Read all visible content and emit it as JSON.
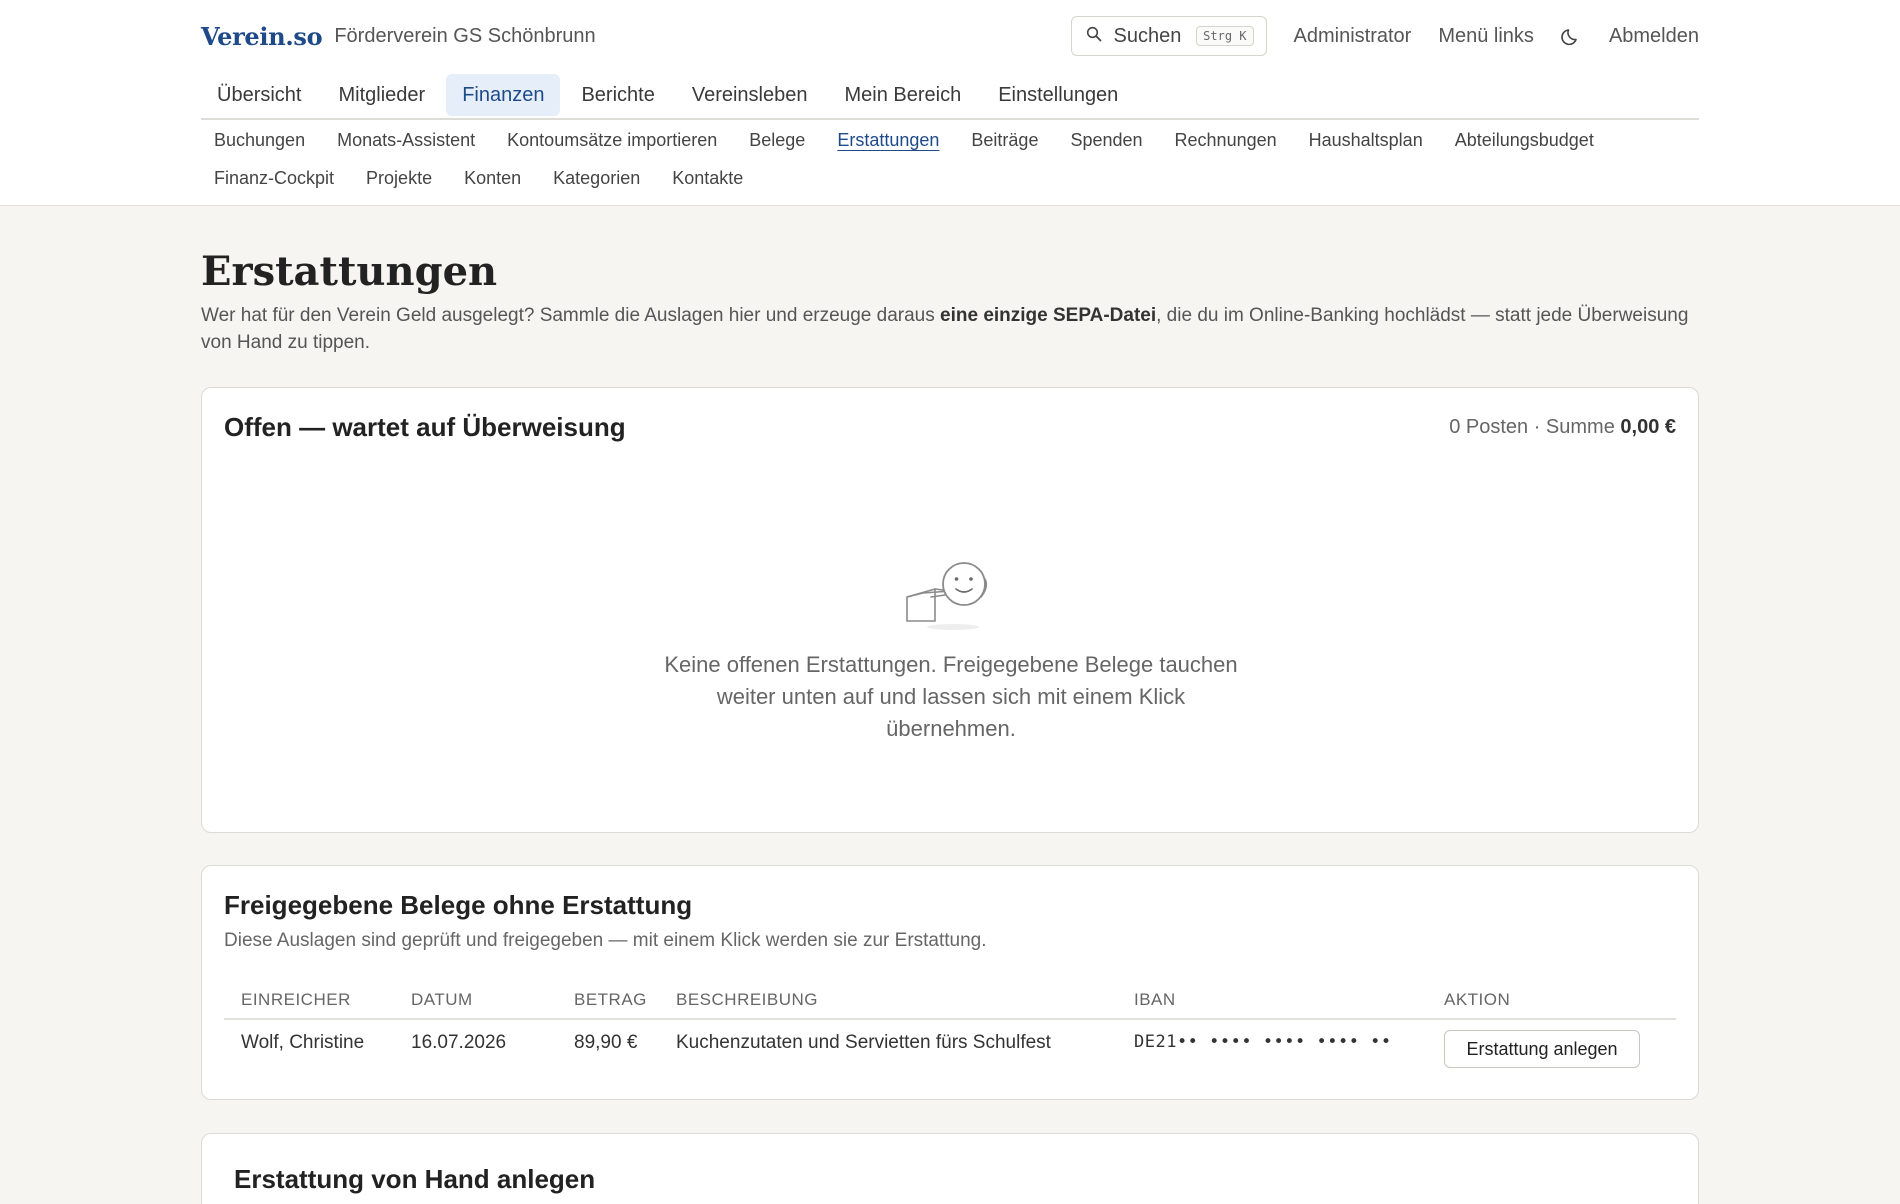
{
  "header": {
    "logo": "Verein.so",
    "org_name": "Förderverein GS Schönbrunn",
    "search": {
      "label": "Suchen",
      "shortcut": "Strg K",
      "icon": "search-icon"
    },
    "user": "Administrator",
    "menu_position": "Menü links",
    "theme_icon": "moon-icon",
    "logout": "Abmelden"
  },
  "main_nav": {
    "tabs": [
      {
        "label": "Übersicht"
      },
      {
        "label": "Mitglieder"
      },
      {
        "label": "Finanzen",
        "active": true
      },
      {
        "label": "Berichte"
      },
      {
        "label": "Vereinsleben"
      },
      {
        "label": "Mein Bereich"
      },
      {
        "label": "Einstellungen"
      }
    ]
  },
  "sub_nav": {
    "items": [
      {
        "label": "Buchungen"
      },
      {
        "label": "Monats-Assistent"
      },
      {
        "label": "Kontoumsätze importieren"
      },
      {
        "label": "Belege"
      },
      {
        "label": "Erstattungen",
        "active": true
      },
      {
        "label": "Beiträge"
      },
      {
        "label": "Spenden"
      },
      {
        "label": "Rechnungen"
      },
      {
        "label": "Haushaltsplan"
      },
      {
        "label": "Abteilungsbudget"
      },
      {
        "label": "Finanz-Cockpit"
      },
      {
        "label": "Projekte"
      },
      {
        "label": "Konten"
      },
      {
        "label": "Kategorien"
      },
      {
        "label": "Kontakte"
      }
    ]
  },
  "page": {
    "title": "Erstattungen",
    "intro_before": "Wer hat für den Verein Geld ausgelegt? Sammle die Auslagen hier und erzeuge daraus ",
    "intro_bold": "eine einzige SEPA-Datei",
    "intro_after": ", die du im Online-Banking hochlädst — statt jede Überweisung von Hand zu tippen."
  },
  "open_card": {
    "title": "Offen — wartet auf Überweisung",
    "count_text": "0 Posten · Summe ",
    "sum": "0,00 €",
    "empty_text": "Keine offenen Erstattungen. Freigegebene Belege tauchen weiter unten auf und lassen sich mit einem Klick übernehmen."
  },
  "approved_card": {
    "title": "Freigegebene Belege ohne Erstattung",
    "subtitle": "Diese Auslagen sind geprüft und freigegeben — mit einem Klick werden sie zur Erstattung.",
    "columns": [
      "EINREICHER",
      "DATUM",
      "BETRAG",
      "BESCHREIBUNG",
      "IBAN",
      "AKTION"
    ],
    "rows": [
      {
        "submitter": "Wolf, Christine",
        "date": "16.07.2026",
        "amount": "89,90 €",
        "description": "Kuchenzutaten und Servietten fürs Schulfest",
        "iban": "DE21•• •••• •••• •••• ••",
        "action": "Erstattung anlegen"
      }
    ]
  },
  "manual_card": {
    "title": "Erstattung von Hand anlegen"
  }
}
